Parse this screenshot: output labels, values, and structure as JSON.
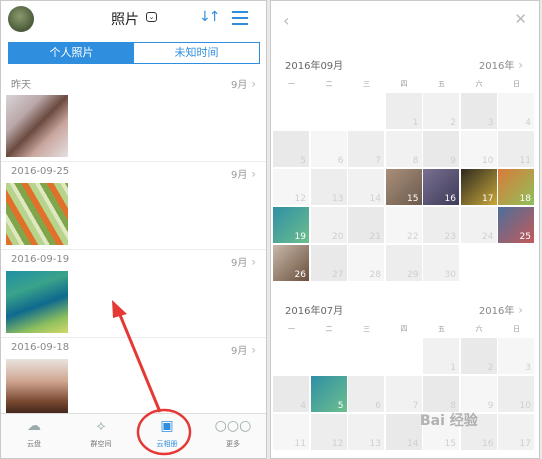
{
  "left": {
    "title": "照片",
    "tabs": [
      {
        "label": "个人照片",
        "active": true
      },
      {
        "label": "未知时间",
        "active": false
      }
    ],
    "groups": [
      {
        "date": "昨天",
        "month": "9月"
      },
      {
        "date": "2016-09-25",
        "month": "9月"
      },
      {
        "date": "2016-09-19",
        "month": "9月"
      },
      {
        "date": "2016-09-18",
        "month": "9月"
      }
    ],
    "bottom_tabs": [
      {
        "label": "云盘",
        "icon": "cloud-icon"
      },
      {
        "label": "群空间",
        "icon": "group-space-icon"
      },
      {
        "label": "云相册",
        "icon": "cloud-album-icon",
        "active": true
      },
      {
        "label": "更多",
        "icon": "more-icon"
      }
    ]
  },
  "right": {
    "weekdays": [
      "一",
      "二",
      "三",
      "四",
      "五",
      "六",
      "日"
    ],
    "months": [
      {
        "title": "2016年09月",
        "year": "2016年",
        "rows": [
          [
            "",
            "",
            "",
            "1",
            "2",
            "3",
            "4"
          ],
          [
            "5",
            "6",
            "7",
            "8",
            "9",
            "10",
            "11"
          ],
          [
            "12",
            "13",
            "14",
            "15",
            "16",
            "17",
            "18"
          ],
          [
            "19",
            "20",
            "21",
            "22",
            "23",
            "24",
            "25"
          ],
          [
            "26",
            "27",
            "28",
            "29",
            "30",
            "",
            ""
          ]
        ],
        "photo_days": [
          "15",
          "16",
          "17",
          "18",
          "19",
          "25",
          "26"
        ]
      },
      {
        "title": "2016年07月",
        "year": "2016年",
        "rows": [
          [
            "",
            "",
            "",
            "",
            "1",
            "2",
            "3"
          ],
          [
            "4",
            "5",
            "6",
            "7",
            "8",
            "9",
            "10"
          ],
          [
            "11",
            "12",
            "13",
            "14",
            "15",
            "16",
            "17"
          ]
        ],
        "photo_days": [
          "5"
        ]
      }
    ]
  },
  "watermark": "Bai 经验"
}
